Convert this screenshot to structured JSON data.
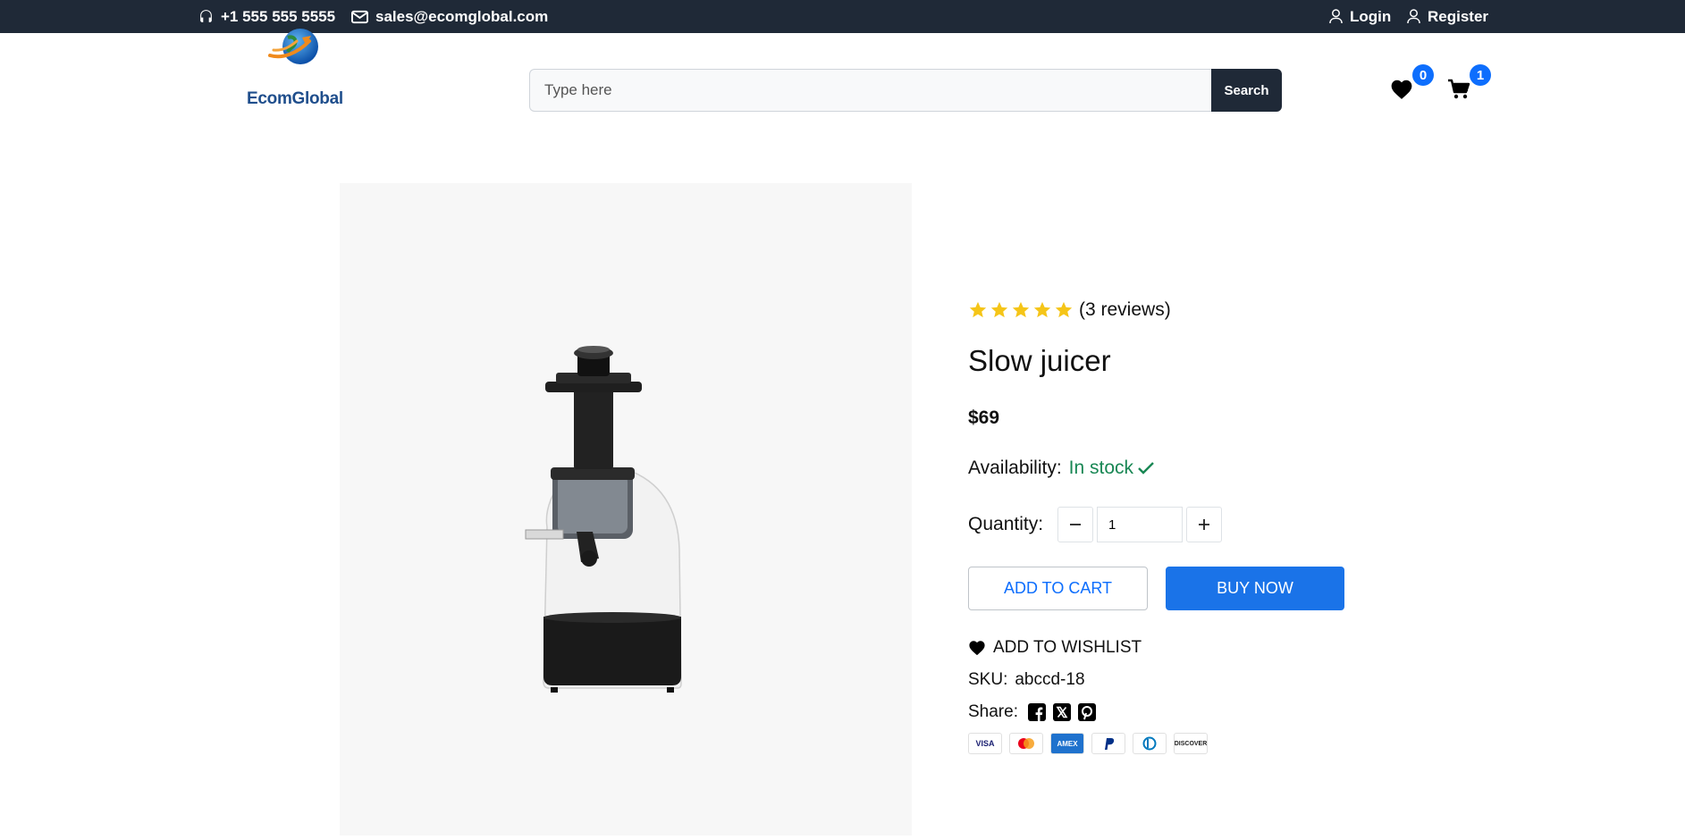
{
  "topbar": {
    "phone": "+1 555 555 5555",
    "email": "sales@ecomglobal.com",
    "login": "Login",
    "register": "Register"
  },
  "header": {
    "logo_text": "EcomGlobal",
    "search_placeholder": "Type here",
    "search_button": "Search",
    "wishlist_count": "0",
    "cart_count": "1"
  },
  "product": {
    "rating_stars": 5,
    "reviews": "(3 reviews)",
    "title": "Slow juicer",
    "price": "$69",
    "availability_label": "Availability:",
    "availability_value": "In stock",
    "quantity_label": "Quantity:",
    "quantity_value": "1",
    "add_to_cart": "ADD TO CART",
    "buy_now": "BUY NOW",
    "add_to_wishlist": "ADD TO WISHLIST",
    "sku_label": "SKU:",
    "sku_value": "abccd-18",
    "share_label": "Share:"
  },
  "payments": {
    "visa": "VISA",
    "amex": "AMEX",
    "discover": "DISCOVER"
  },
  "colors": {
    "topbar_bg": "#1f2937",
    "accent": "#1a73e8",
    "badge": "#0d6efd",
    "in_stock": "#198754",
    "star": "#f5c518"
  }
}
